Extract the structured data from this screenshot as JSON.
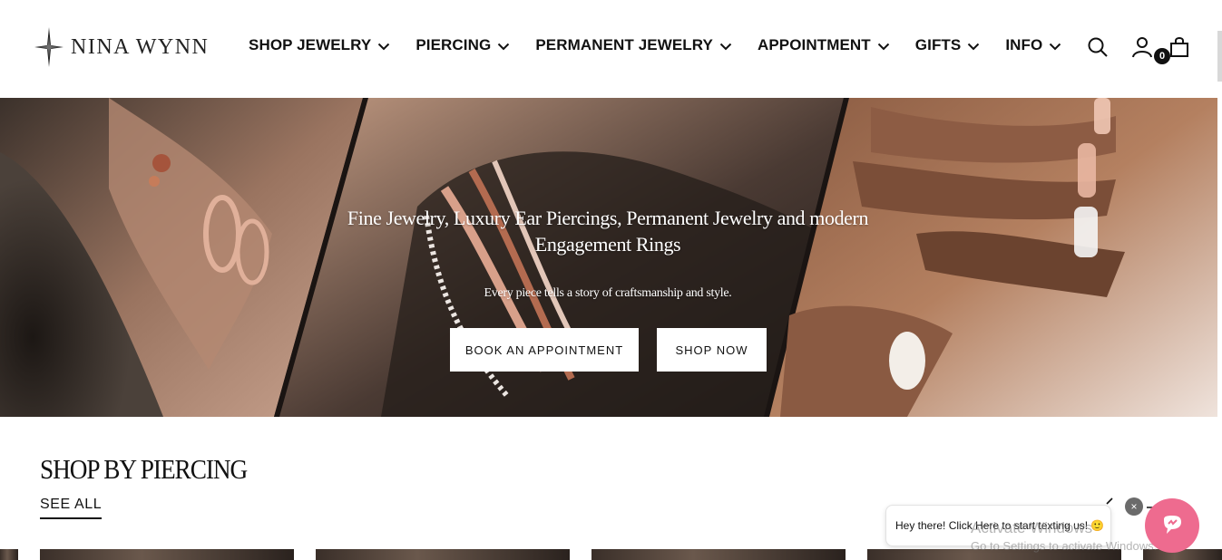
{
  "brand": {
    "name": "NINA WYNN",
    "logo_icon": "compass-star-icon"
  },
  "nav": {
    "items": [
      {
        "label": "SHOP JEWELRY"
      },
      {
        "label": "PIERCING"
      },
      {
        "label": "PERMANENT JEWELRY"
      },
      {
        "label": "APPOINTMENT"
      },
      {
        "label": "GIFTS"
      },
      {
        "label": "INFO"
      }
    ]
  },
  "header_icons": {
    "search": "search-icon",
    "account": "account-icon",
    "cart": "shopping-bag-icon",
    "cart_count": "0"
  },
  "hero": {
    "title": "Fine Jewelry, Luxury Ear Piercings, Permanent Jewelry and modern Engagement Rings",
    "subtitle": "Every piece tells a story of craftsmanship and style.",
    "buttons": {
      "book": "BOOK AN APPOINTMENT",
      "shop": "SHOP NOW"
    }
  },
  "section": {
    "title": "SHOP BY PIERCING",
    "see_all": "SEE ALL"
  },
  "chat": {
    "message": "Hey there! Click Here to start texting us! 🙂",
    "close": "×"
  },
  "watermark": {
    "line1": "Activate Windows",
    "line2": "Go to Settings to activate Windows."
  },
  "colors": {
    "chat_accent": "#ee6b8f",
    "text": "#111111"
  }
}
